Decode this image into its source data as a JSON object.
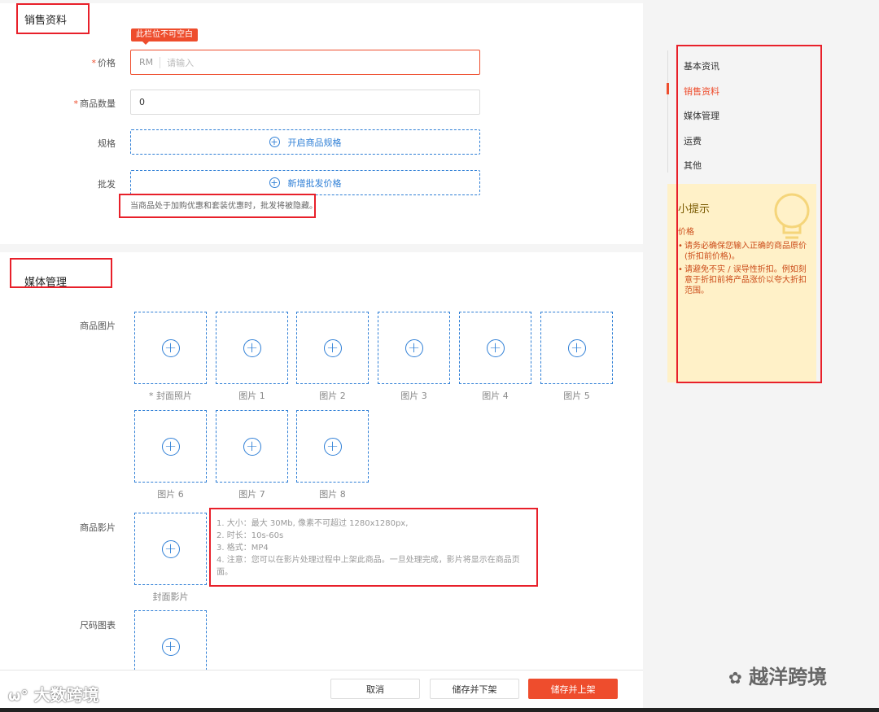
{
  "sales": {
    "title": "销售资料",
    "price": {
      "label": "价格",
      "required": "*",
      "prefix": "RM",
      "placeholder": "请输入",
      "error": "此栏位不可空白"
    },
    "quantity": {
      "label": "商品数量",
      "required": "*",
      "value": "0"
    },
    "spec": {
      "label": "规格",
      "button": "开启商品规格"
    },
    "wholesale": {
      "label": "批发",
      "button": "新增批发价格",
      "hint": "当商品处于加购优惠和套装优惠时，批发将被隐藏。"
    }
  },
  "media": {
    "title": "媒体管理",
    "images_label": "商品图片",
    "images": [
      "* 封面照片",
      "图片 1",
      "图片 2",
      "图片 3",
      "图片 4",
      "图片 5",
      "图片 6",
      "图片 7",
      "图片 8"
    ],
    "video_label": "商品影片",
    "video_caption": "封面影片",
    "video_notes": [
      "1. 大小：最大 30Mb, 像素不可超过 1280x1280px,",
      "2. 时长：10s-60s",
      "3. 格式：MP4",
      "4. 注意：您可以在影片处理过程中上架此商品。一旦处理完成，影片将显示在商品页面。"
    ],
    "size_chart_label": "尺码图表"
  },
  "footer": {
    "cancel": "取消",
    "save_delist": "储存并下架",
    "save_publish": "储存并上架"
  },
  "nav": {
    "items": [
      "基本资讯",
      "销售资料",
      "媒体管理",
      "运费",
      "其他"
    ],
    "active_index": 1
  },
  "tips": {
    "title": "小提示",
    "subtitle": "价格",
    "items": [
      "请务必确保您输入正确的商品原价 (折扣前价格)。",
      "请避免不实 / 误导性折扣。例如刻意于折扣前将产品涨价以夸大折扣范围。"
    ]
  },
  "watermarks": {
    "left": "大数跨境",
    "right": "越洋跨境"
  },
  "colors": {
    "accent": "#ee4d2d",
    "link": "#2f7fd6",
    "annotation": "#e8202a",
    "tips_bg": "#fff1c8"
  }
}
